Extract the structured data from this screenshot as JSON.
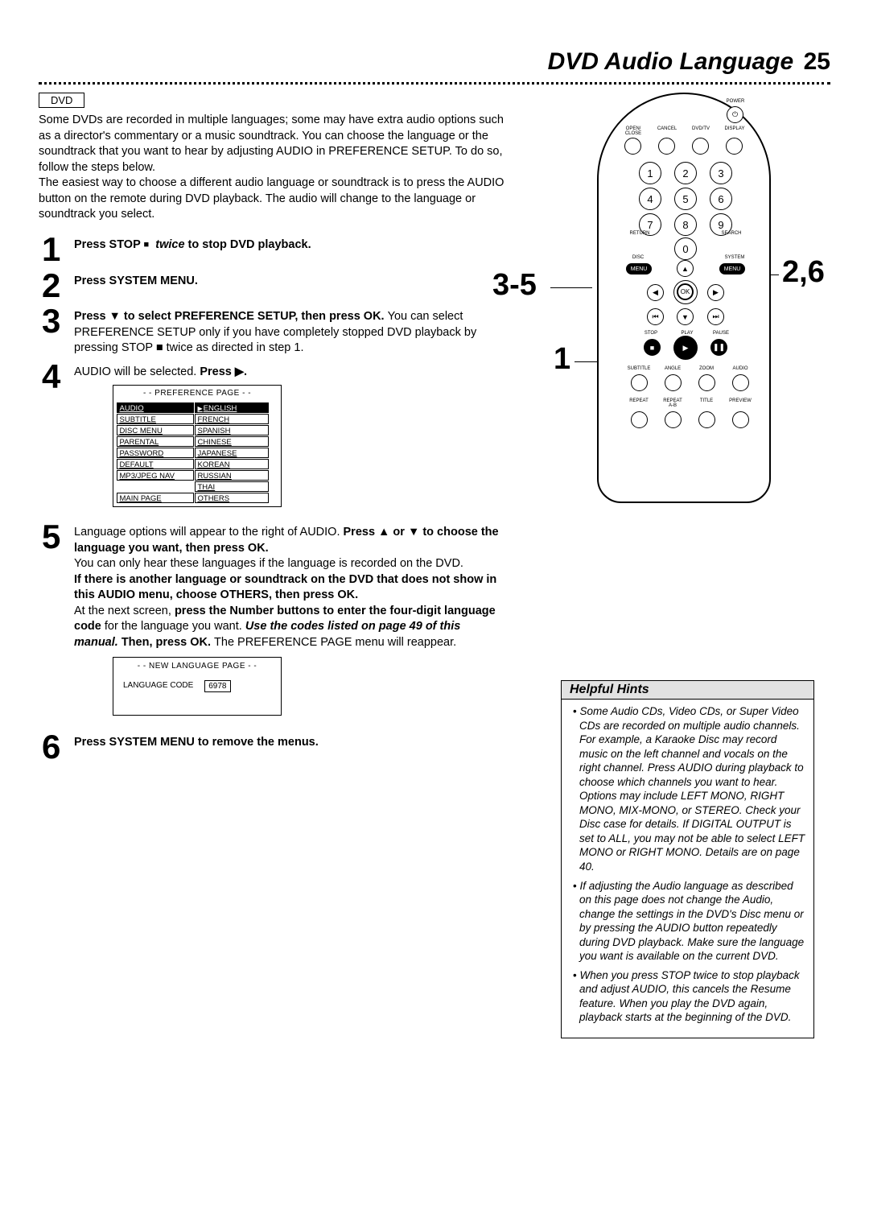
{
  "page_title": "DVD Audio Language",
  "page_number": "25",
  "label_box": "DVD",
  "intro": "Some DVDs are recorded in multiple languages; some may have extra audio options such as a director's commentary or a music soundtrack. You can choose the language or the soundtrack that you want to hear by adjusting AUDIO in PREFERENCE SETUP.  To do so, follow the steps below.\nThe easiest way to choose a different audio language or soundtrack is to press the AUDIO button on the remote during DVD playback. The audio will change to the language or soundtrack you select.",
  "steps": {
    "s1_a": "Press STOP ",
    "s1_b": "twice",
    "s1_c": " to stop DVD playback.",
    "s2": "Press SYSTEM MENU.",
    "s3_a": "Press ▼ to select PREFERENCE SETUP, then press OK. ",
    "s3_b": "You can select PREFERENCE SETUP only if you have completely stopped DVD playback by pressing STOP ■ twice as directed in step 1.",
    "s4_a": "AUDIO will be selected. ",
    "s4_b": "Press ▶.",
    "s5_a": "Language options will appear to the right of AUDIO. ",
    "s5_b": "Press ▲ or ▼ to choose the language you want, then press OK.",
    "s5_c": "You can only hear these languages if the language is recorded on the DVD.",
    "s5_d": "If there is another language or soundtrack on the DVD that does not show in this AUDIO menu, choose OTHERS, then press OK.",
    "s5_e_a": "At the next screen, ",
    "s5_e_b": "press the Number buttons to enter the four-digit language code",
    "s5_e_c": " for the language you want. ",
    "s5_e_d": "Use the codes listed on page 49 of this manual.",
    "s5_e_e": " Then, press OK. ",
    "s5_e_f": "The PREFERENCE PAGE menu will reappear.",
    "s6": "Press SYSTEM MENU to remove the menus."
  },
  "osd1": {
    "title": "- -   PREFERENCE PAGE   - -",
    "left": [
      "AUDIO",
      "SUBTITLE",
      "DISC MENU",
      "PARENTAL",
      "PASSWORD",
      "DEFAULT",
      "MP3/JPEG NAV",
      "",
      "MAIN PAGE"
    ],
    "right": [
      "ENGLISH",
      "FRENCH",
      "SPANISH",
      "CHINESE",
      "JAPANESE",
      "KOREAN",
      "RUSSIAN",
      "THAI",
      "OTHERS"
    ]
  },
  "osd2": {
    "title": "- -   NEW LANGUAGE PAGE   - -",
    "label": "LANGUAGE CODE",
    "code": "6978"
  },
  "remote": {
    "top_labels": [
      "OPEN/\nCLOSE",
      "CANCEL",
      "DVD/TV",
      "DISPLAY"
    ],
    "power": "POWER",
    "nums": [
      "1",
      "2",
      "3",
      "4",
      "5",
      "6",
      "7",
      "8",
      "9",
      "0"
    ],
    "return": "RETURN",
    "search": "SEARCH",
    "disc": "DISC",
    "system": "SYSTEM",
    "menu": "MENU",
    "ok": "OK",
    "stop": "STOP",
    "play": "PLAY",
    "pause": "PAUSE",
    "bottom_labels": [
      "SUBTITLE",
      "ANGLE",
      "ZOOM",
      "AUDIO",
      "REPEAT",
      "REPEAT\nA-B",
      "TITLE",
      "PREVIEW"
    ]
  },
  "callouts": {
    "left_upper": "3-5",
    "left_lower": "1",
    "right": "2,6"
  },
  "hints": {
    "title": "Helpful Hints",
    "items": [
      "Some Audio CDs, Video CDs, or Super Video CDs are recorded on multiple audio channels. For example, a Karaoke Disc may record music on the left channel and vocals on the right channel. Press AUDIO during playback to choose which channels you want to hear. Options may include LEFT MONO, RIGHT MONO, MIX-MONO, or STEREO. Check your Disc case for details. If DIGITAL OUTPUT is set to ALL, you may not be able to select LEFT MONO or RIGHT MONO. Details are on page 40.",
      "If adjusting the Audio language as described on this page does not change the Audio, change the settings in the DVD's Disc menu or by pressing the AUDIO button repeatedly during DVD playback. Make sure the language you want is available on the current DVD.",
      "When you press STOP twice to stop playback and adjust AUDIO, this cancels the Resume feature. When you play the DVD again, playback starts at the beginning of the DVD."
    ]
  }
}
